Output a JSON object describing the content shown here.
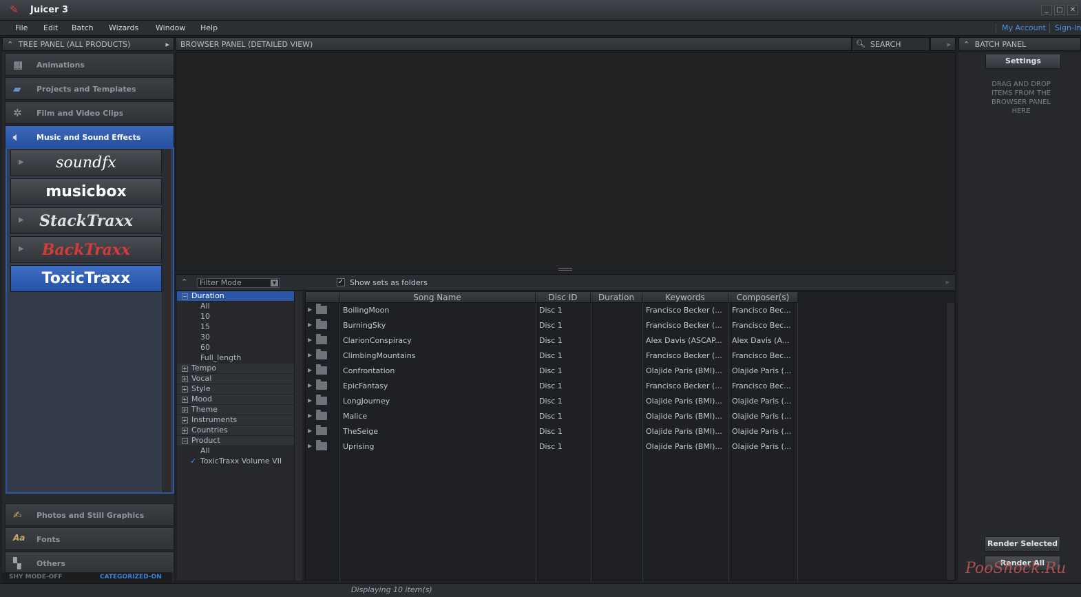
{
  "app": {
    "title": "Juicer 3"
  },
  "window_buttons": [
    "_",
    "□",
    "✕"
  ],
  "menu": {
    "items": [
      "File",
      "Edit",
      "Batch",
      "Wizards",
      "Window",
      "Help"
    ],
    "account": "My Account",
    "signin": "Sign-In"
  },
  "tree_panel": {
    "header": "TREE PANEL (ALL PRODUCTS)",
    "categories_top": [
      {
        "label": "Animations",
        "icon": "film-strip-icon"
      },
      {
        "label": "Projects and Templates",
        "icon": "projects-icon"
      },
      {
        "label": "Film and Video Clips",
        "icon": "film-reel-icon"
      },
      {
        "label": "Music and Sound Effects",
        "icon": "speaker-icon"
      }
    ],
    "logos": [
      "soundfx",
      "musicbox",
      "StackTraxx",
      "BackTraxx",
      "ToxicTraxx"
    ],
    "categories_bottom": [
      {
        "label": "Photos and Still Graphics",
        "icon": "palette-icon"
      },
      {
        "label": "Fonts",
        "icon": "font-icon"
      },
      {
        "label": "Others",
        "icon": "others-icon"
      }
    ],
    "shy_mode": "SHY MODE-OFF",
    "categorized": "CATEGORIZED-ON"
  },
  "browser_panel": {
    "header": "BROWSER PANEL (DETAILED VIEW)",
    "search_label": "SEARCH"
  },
  "filter": {
    "mode_value": "Filter Mode",
    "show_sets_label": "Show sets as folders",
    "show_sets_checked": true,
    "tree": {
      "duration_label": "Duration",
      "duration_items": [
        "All",
        "10",
        "15",
        "30",
        "60",
        "Full_length"
      ],
      "groups": [
        "Tempo",
        "Vocal",
        "Style",
        "Mood",
        "Theme",
        "Instruments",
        "Countries"
      ],
      "product_label": "Product",
      "product_items": [
        "All",
        "ToxicTraxx Volume VII"
      ]
    }
  },
  "grid": {
    "columns": [
      "Song Name",
      "Disc ID",
      "Duration",
      "Keywords",
      "Composer(s)"
    ],
    "rows": [
      {
        "name": "BoilingMoon",
        "disc": "Disc 1",
        "duration": "",
        "keywords": "Francisco Becker (...",
        "composer": "Francisco Bec..."
      },
      {
        "name": "BurningSky",
        "disc": "Disc 1",
        "duration": "",
        "keywords": "Francisco Becker (...",
        "composer": "Francisco Bec..."
      },
      {
        "name": "ClarionConspiracy",
        "disc": "Disc 1",
        "duration": "",
        "keywords": "Alex Davis (ASCAP...",
        "composer": "Alex Davis (A..."
      },
      {
        "name": "ClimbingMountains",
        "disc": "Disc 1",
        "duration": "",
        "keywords": "Francisco Becker (...",
        "composer": "Francisco Bec..."
      },
      {
        "name": "Confrontation",
        "disc": "Disc 1",
        "duration": "",
        "keywords": "Olajide Paris (BMI)...",
        "composer": "Olajide Paris (..."
      },
      {
        "name": "EpicFantasy",
        "disc": "Disc 1",
        "duration": "",
        "keywords": "Francisco Becker (...",
        "composer": "Francisco Bec..."
      },
      {
        "name": "LongJourney",
        "disc": "Disc 1",
        "duration": "",
        "keywords": "Olajide Paris (BMI)...",
        "composer": "Olajide Paris (..."
      },
      {
        "name": "Malice",
        "disc": "Disc 1",
        "duration": "",
        "keywords": "Olajide Paris (BMI)...",
        "composer": "Olajide Paris (..."
      },
      {
        "name": "TheSeige",
        "disc": "Disc 1",
        "duration": "",
        "keywords": "Olajide Paris (BMI)...",
        "composer": "Olajide Paris (..."
      },
      {
        "name": "Uprising",
        "disc": "Disc 1",
        "duration": "",
        "keywords": "Olajide Paris (BMI)...",
        "composer": "Olajide Paris (..."
      }
    ]
  },
  "batch_panel": {
    "header": "BATCH PANEL",
    "settings": "Settings",
    "hint": "DRAG AND DROP ITEMS FROM THE BROWSER PANEL HERE",
    "render_selected": "Render Selected",
    "render_all": "Render All"
  },
  "status": {
    "text": "Displaying 10 item(s)"
  },
  "watermark": "PooShock.Ru",
  "colors": {
    "accent": "#2b56a6",
    "link": "#4f8fe0",
    "background": "#1f2124"
  }
}
